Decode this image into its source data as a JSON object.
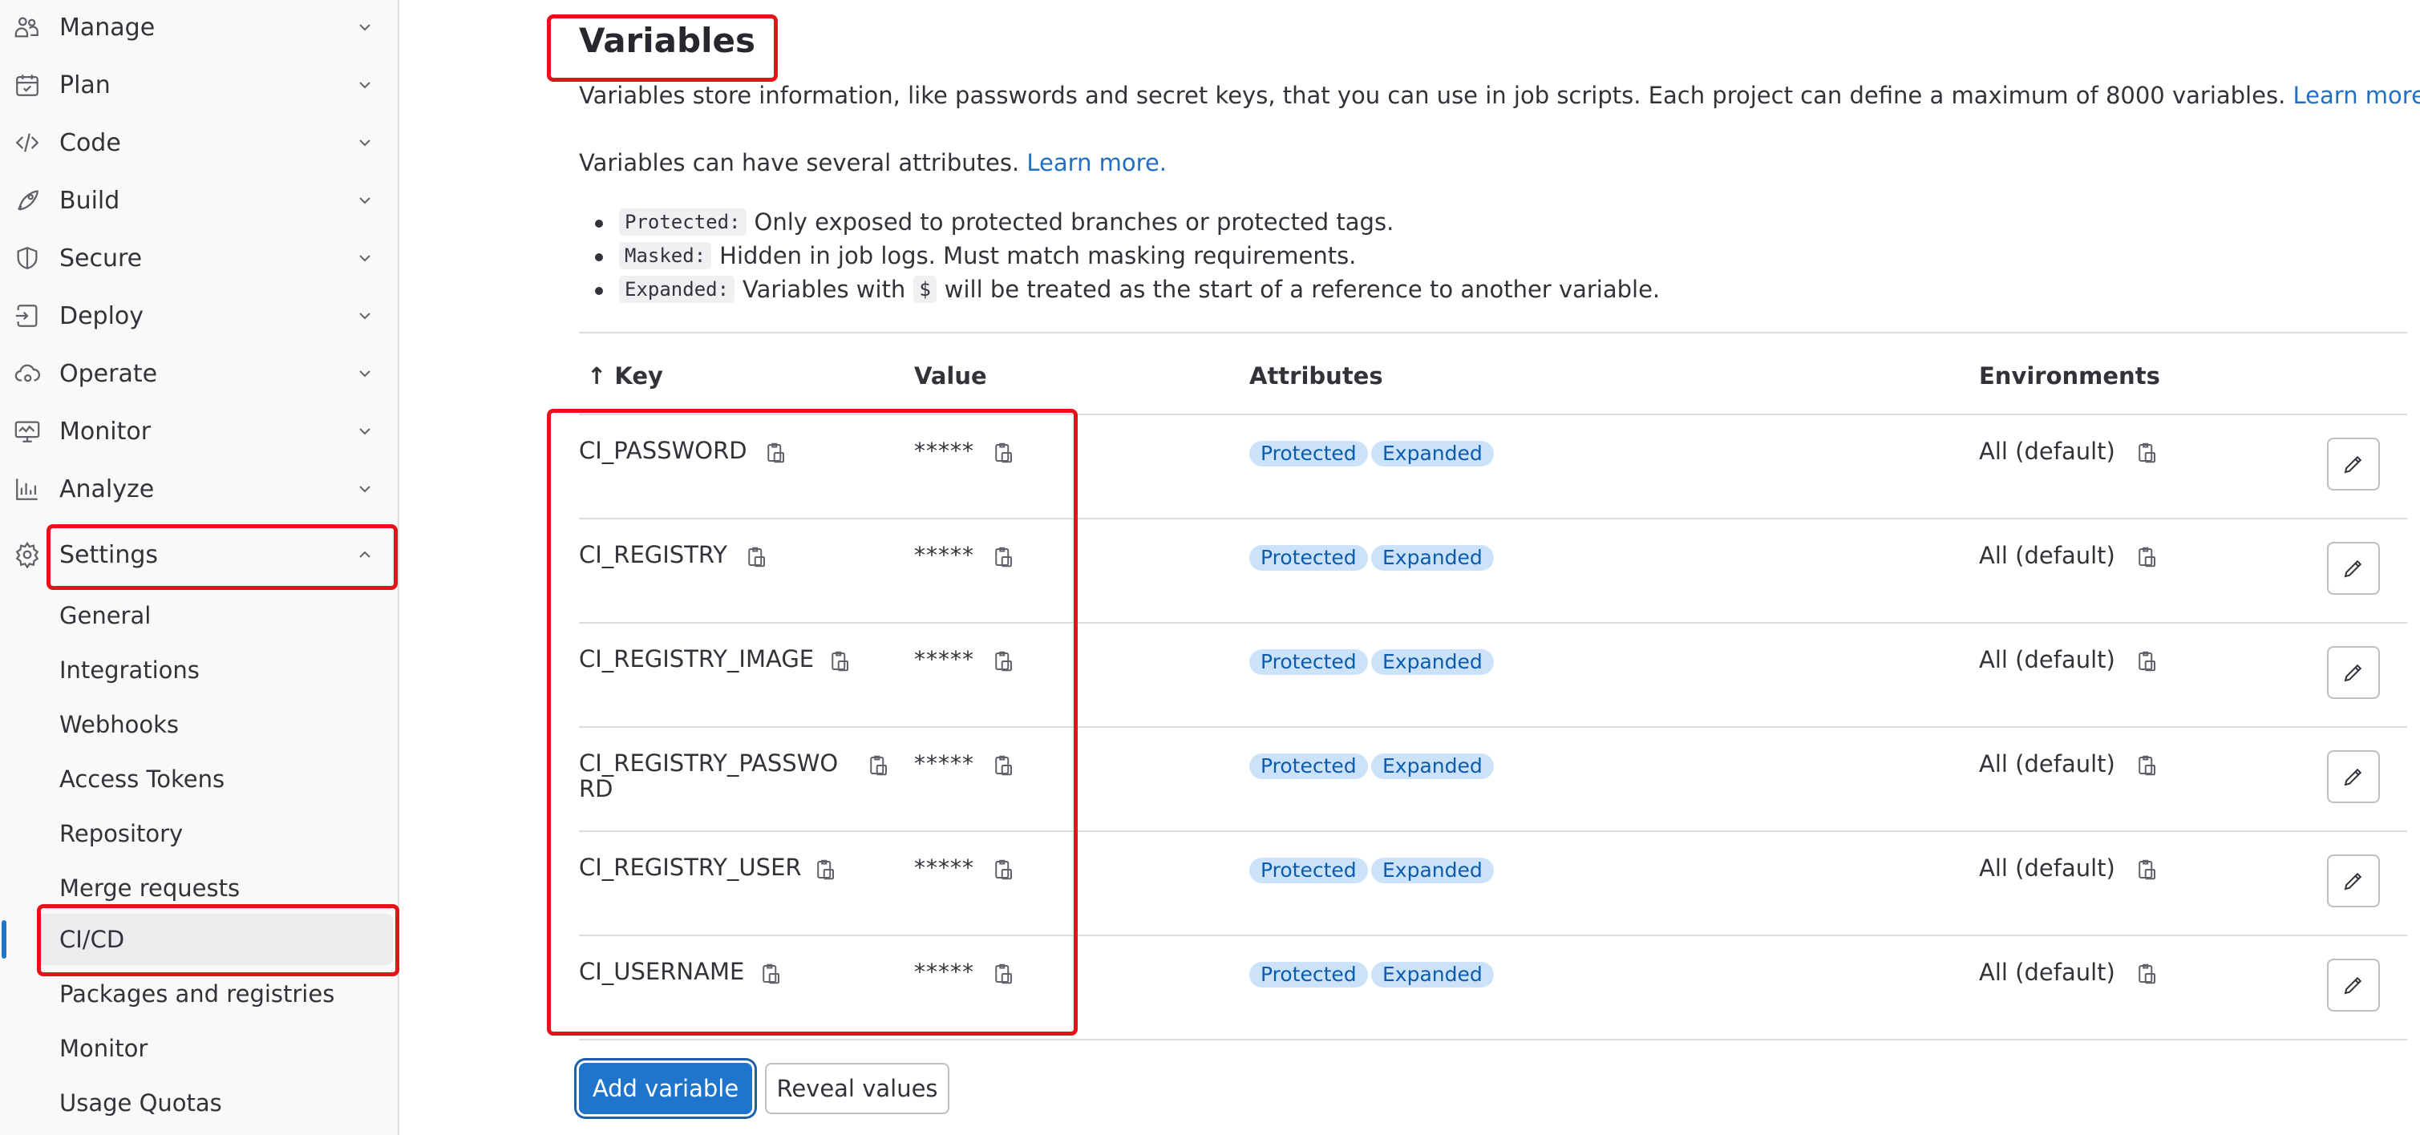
{
  "sidebar": {
    "items": [
      {
        "label": "Manage",
        "icon": "users-icon"
      },
      {
        "label": "Plan",
        "icon": "calendar-icon"
      },
      {
        "label": "Code",
        "icon": "code-icon"
      },
      {
        "label": "Build",
        "icon": "rocket-icon"
      },
      {
        "label": "Secure",
        "icon": "shield-icon"
      },
      {
        "label": "Deploy",
        "icon": "deploy-icon"
      },
      {
        "label": "Operate",
        "icon": "cloud-gear-icon"
      },
      {
        "label": "Monitor",
        "icon": "monitor-icon"
      },
      {
        "label": "Analyze",
        "icon": "chart-icon"
      },
      {
        "label": "Settings",
        "icon": "gear-icon"
      }
    ],
    "settings_sub": [
      {
        "label": "General"
      },
      {
        "label": "Integrations"
      },
      {
        "label": "Webhooks"
      },
      {
        "label": "Access Tokens"
      },
      {
        "label": "Repository"
      },
      {
        "label": "Merge requests"
      },
      {
        "label": "CI/CD"
      },
      {
        "label": "Packages and registries"
      },
      {
        "label": "Monitor"
      },
      {
        "label": "Usage Quotas"
      }
    ]
  },
  "main": {
    "title": "Variables",
    "description": "Variables store information, like passwords and secret keys, that you can use in job scripts. Each project can define a maximum of 8000 variables.",
    "learn_more_1": "Learn more.",
    "attributes_intro": "Variables can have several attributes.",
    "learn_more_2": "Learn more.",
    "attributes": [
      {
        "code": "Protected:",
        "text": "Only exposed to protected branches or protected tags."
      },
      {
        "code": "Masked:",
        "text": "Hidden in job logs. Must match masking requirements."
      },
      {
        "code": "Expanded:",
        "text_before": "Variables with",
        "inline_code": "$",
        "text_after": "will be treated as the start of a reference to another variable."
      }
    ],
    "table": {
      "headers": {
        "key": "↑ Key",
        "value": "Value",
        "attributes": "Attributes",
        "environments": "Environments"
      },
      "rows": [
        {
          "key": "CI_PASSWORD",
          "value": "*****",
          "badge1": "Protected",
          "badge2": "Expanded",
          "env": "All (default)"
        },
        {
          "key": "CI_REGISTRY",
          "value": "*****",
          "badge1": "Protected",
          "badge2": "Expanded",
          "env": "All (default)"
        },
        {
          "key": "CI_REGISTRY_IMAGE",
          "value": "*****",
          "badge1": "Protected",
          "badge2": "Expanded",
          "env": "All (default)"
        },
        {
          "key": "CI_REGISTRY_PASSWORD",
          "value": "*****",
          "badge1": "Protected",
          "badge2": "Expanded",
          "env": "All (default)"
        },
        {
          "key": "CI_REGISTRY_USER",
          "value": "*****",
          "badge1": "Protected",
          "badge2": "Expanded",
          "env": "All (default)"
        },
        {
          "key": "CI_USERNAME",
          "value": "*****",
          "badge1": "Protected",
          "badge2": "Expanded",
          "env": "All (default)"
        }
      ]
    },
    "add_variable": "Add variable",
    "reveal_values": "Reveal values"
  },
  "colors": {
    "accent": "#1f75cb",
    "badge_bg": "#cbe2f9",
    "badge_text": "#0b5cad",
    "highlight": "#e5121a"
  }
}
